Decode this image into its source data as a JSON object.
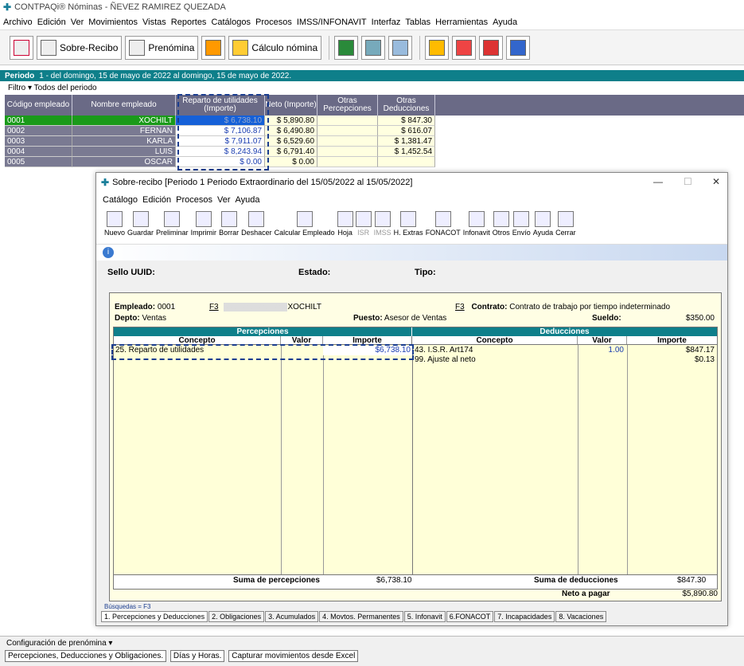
{
  "app": {
    "logo": "✚",
    "title": "CONTPAQi® Nóminas - ÑEVEZ RAMIREZ QUEZADA"
  },
  "menu": [
    "Archivo",
    "Edición",
    "Ver",
    "Movimientos",
    "Vistas",
    "Reportes",
    "Catálogos",
    "Procesos",
    "IMSS/INFONAVIT",
    "Interfaz",
    "Tablas",
    "Herramientas",
    "Ayuda"
  ],
  "toolbar": {
    "sobre_recibo": "Sobre-Recibo",
    "prenomina": "Prenómina",
    "calculo": "Cálculo nómina"
  },
  "periodo": {
    "label": "Periodo",
    "text": "1 - del domingo, 15 de mayo de 2022 al domingo, 15 de mayo de 2022."
  },
  "filtro": {
    "label": "Filtro",
    "value": "Todos del periodo"
  },
  "grid": {
    "headers": [
      "Código empleado",
      "Nombre empleado",
      "Reparto de utilidades (Importe)",
      "Neto (Importe)",
      "Otras Percepciones",
      "Otras Deducciones"
    ],
    "rows": [
      {
        "code": "0001",
        "name": "XOCHILT",
        "reparto": "$ 6,738.10",
        "neto": "$ 5,890.80",
        "otras_p": "",
        "otras_d": "$ 847.30"
      },
      {
        "code": "0002",
        "name": "FERNAN",
        "reparto": "$ 7,106.87",
        "neto": "$ 6,490.80",
        "otras_p": "",
        "otras_d": "$ 616.07"
      },
      {
        "code": "0003",
        "name": "KARLA",
        "reparto": "$ 7,911.07",
        "neto": "$ 6,529.60",
        "otras_p": "",
        "otras_d": "$ 1,381.47"
      },
      {
        "code": "0004",
        "name": "LUIS",
        "reparto": "$ 8,243.94",
        "neto": "$ 6,791.40",
        "otras_p": "",
        "otras_d": "$ 1,452.54"
      },
      {
        "code": "0005",
        "name": "OSCAR",
        "reparto": "$ 0.00",
        "neto": "$ 0.00",
        "otras_p": "",
        "otras_d": ""
      }
    ]
  },
  "dialog": {
    "title": "Sobre-recibo  [Periodo 1 Periodo Extraordinario del 15/05/2022 al 15/05/2022]",
    "menu": [
      "Catálogo",
      "Edición",
      "Procesos",
      "Ver",
      "Ayuda"
    ],
    "tools": [
      "Nuevo",
      "Guardar",
      "Preliminar",
      "Imprimir",
      "Borrar",
      "Deshacer",
      "Calcular Empleado",
      "Hoja",
      "ISR",
      "IMSS",
      "H. Extras",
      "FONACOT",
      "Infonavit",
      "Otros",
      "Envío",
      "Ayuda",
      "Cerrar"
    ],
    "sello": "Sello UUID:",
    "estado": "Estado:",
    "tipo": "Tipo:",
    "empleado_label": "Empleado:",
    "empleado_code": "0001",
    "f3": "F3",
    "empleado_name": "XOCHILT",
    "contrato_label": "Contrato:",
    "contrato": "Contrato de trabajo por tiempo indeterminado",
    "depto_label": "Depto:",
    "depto": "Ventas",
    "puesto_label": "Puesto:",
    "puesto": "Asesor de Ventas",
    "sueldo_label": "Sueldo:",
    "sueldo": "$350.00",
    "percepciones": "Percepciones",
    "deducciones": "Deducciones",
    "concepto": "Concepto",
    "valor": "Valor",
    "importe": "Importe",
    "perc_rows": [
      {
        "concepto": "25. Reparto de utilidades",
        "valor": "",
        "importe": "$6,738.10"
      }
    ],
    "ded_rows": [
      {
        "concepto": "43. I.S.R. Art174",
        "valor": "1.00",
        "importe": "$847.17"
      },
      {
        "concepto": "99. Ajuste al neto",
        "valor": "",
        "importe": "$0.13"
      }
    ],
    "suma_perc_label": "Suma de percepciones",
    "suma_perc": "$6,738.10",
    "suma_ded_label": "Suma de deducciones",
    "suma_ded": "$847.30",
    "neto_label": "Neto a pagar",
    "neto": "$5,890.80",
    "busquedas": "Búsquedas = F3",
    "tabs": [
      "1. Percepciones y Deducciones",
      "2. Obligaciones",
      "3. Acumulados",
      "4. Movtos. Permanentes",
      "5. Infonavit",
      "6.FONACOT",
      "7. Incapacidades",
      "8. Vacaciones"
    ]
  },
  "bottom": {
    "config": "Configuración de prenómina",
    "tabs": [
      "Percepciones, Deducciones y Obligaciones.",
      "Días y Horas.",
      "Capturar movimientos desde Excel"
    ]
  }
}
